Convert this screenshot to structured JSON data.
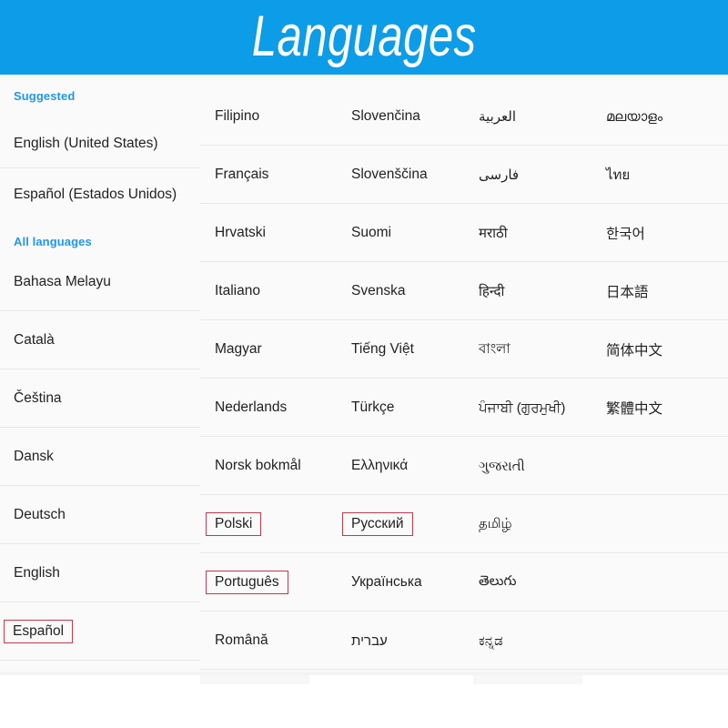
{
  "header": {
    "title": "Languages",
    "background_color": "#0d9ce8",
    "text_color": "#ffffff"
  },
  "theme": {
    "accent_blue": "#2196f3",
    "highlight_border": "#c0394b",
    "row_divider": "#e8e8e8",
    "board_background": "#fafafa",
    "text_color": "#222222"
  },
  "sidebar": {
    "sections": [
      {
        "label": "Suggested",
        "type": "section-header"
      },
      {
        "label": "English (United States)",
        "type": "language",
        "highlighted": false
      },
      {
        "label": "Español (Estados Unidos)",
        "type": "language",
        "highlighted": false
      },
      {
        "label": "All languages",
        "type": "section-header"
      },
      {
        "label": "Bahasa Melayu",
        "type": "language",
        "highlighted": false
      },
      {
        "label": "Català",
        "type": "language",
        "highlighted": false
      },
      {
        "label": "Čeština",
        "type": "language",
        "highlighted": false
      },
      {
        "label": "Dansk",
        "type": "language",
        "highlighted": false
      },
      {
        "label": "Deutsch",
        "type": "language",
        "highlighted": false
      },
      {
        "label": "English",
        "type": "language",
        "highlighted": false
      },
      {
        "label": "Español",
        "type": "language",
        "highlighted": true
      }
    ]
  },
  "grid": {
    "columns": 4,
    "rows": [
      {
        "c1": {
          "label": "Filipino",
          "highlighted": false
        },
        "c2": {
          "label": "Slovenčina",
          "highlighted": false
        },
        "c3": {
          "label": "العربية",
          "highlighted": false,
          "script": "rtl"
        },
        "c4": {
          "label": "മലയാളം",
          "highlighted": false,
          "script": "indic"
        }
      },
      {
        "c1": {
          "label": "Français",
          "highlighted": false
        },
        "c2": {
          "label": "Slovenščina",
          "highlighted": false
        },
        "c3": {
          "label": "فارسی",
          "highlighted": false,
          "script": "rtl"
        },
        "c4": {
          "label": "ไทย",
          "highlighted": false,
          "script": "indic"
        }
      },
      {
        "c1": {
          "label": "Hrvatski",
          "highlighted": false
        },
        "c2": {
          "label": "Suomi",
          "highlighted": false
        },
        "c3": {
          "label": "मराठी",
          "highlighted": false,
          "script": "indic"
        },
        "c4": {
          "label": "한국어",
          "highlighted": false,
          "script": "cjk"
        }
      },
      {
        "c1": {
          "label": "Italiano",
          "highlighted": false
        },
        "c2": {
          "label": "Svenska",
          "highlighted": false
        },
        "c3": {
          "label": "हिन्दी",
          "highlighted": false,
          "script": "indic"
        },
        "c4": {
          "label": "日本語",
          "highlighted": false,
          "script": "cjk"
        }
      },
      {
        "c1": {
          "label": "Magyar",
          "highlighted": false
        },
        "c2": {
          "label": "Tiếng Việt",
          "highlighted": false
        },
        "c3": {
          "label": "বাংলা",
          "highlighted": false,
          "script": "indic"
        },
        "c4": {
          "label": "简体中文",
          "highlighted": false,
          "script": "cjk"
        }
      },
      {
        "c1": {
          "label": "Nederlands",
          "highlighted": false
        },
        "c2": {
          "label": "Türkçe",
          "highlighted": false
        },
        "c3": {
          "label": "ਪੰਜਾਬੀ (ਗੁਰਮੁਖੀ)",
          "highlighted": false,
          "script": "indic"
        },
        "c4": {
          "label": "繁體中文",
          "highlighted": false,
          "script": "cjk"
        }
      },
      {
        "c1": {
          "label": "Norsk bokmål",
          "highlighted": false
        },
        "c2": {
          "label": "Ελληνικά",
          "highlighted": false
        },
        "c3": {
          "label": "ગુજરાતી",
          "highlighted": false,
          "script": "indic"
        },
        "c4": {
          "label": "",
          "highlighted": false
        }
      },
      {
        "c1": {
          "label": "Polski",
          "highlighted": true
        },
        "c2": {
          "label": "Русский",
          "highlighted": true
        },
        "c3": {
          "label": "தமிழ்",
          "highlighted": false,
          "script": "indic"
        },
        "c4": {
          "label": "",
          "highlighted": false
        }
      },
      {
        "c1": {
          "label": "Português",
          "highlighted": true
        },
        "c2": {
          "label": "Українська",
          "highlighted": false
        },
        "c3": {
          "label": "తెలుగు",
          "highlighted": false,
          "script": "indic"
        },
        "c4": {
          "label": "",
          "highlighted": false
        }
      },
      {
        "c1": {
          "label": "Română",
          "highlighted": false
        },
        "c2": {
          "label": "עברית",
          "highlighted": false,
          "script": "rtl"
        },
        "c3": {
          "label": "ಕನ್ನಡ",
          "highlighted": false,
          "script": "indic"
        },
        "c4": {
          "label": "",
          "highlighted": false
        }
      }
    ]
  }
}
